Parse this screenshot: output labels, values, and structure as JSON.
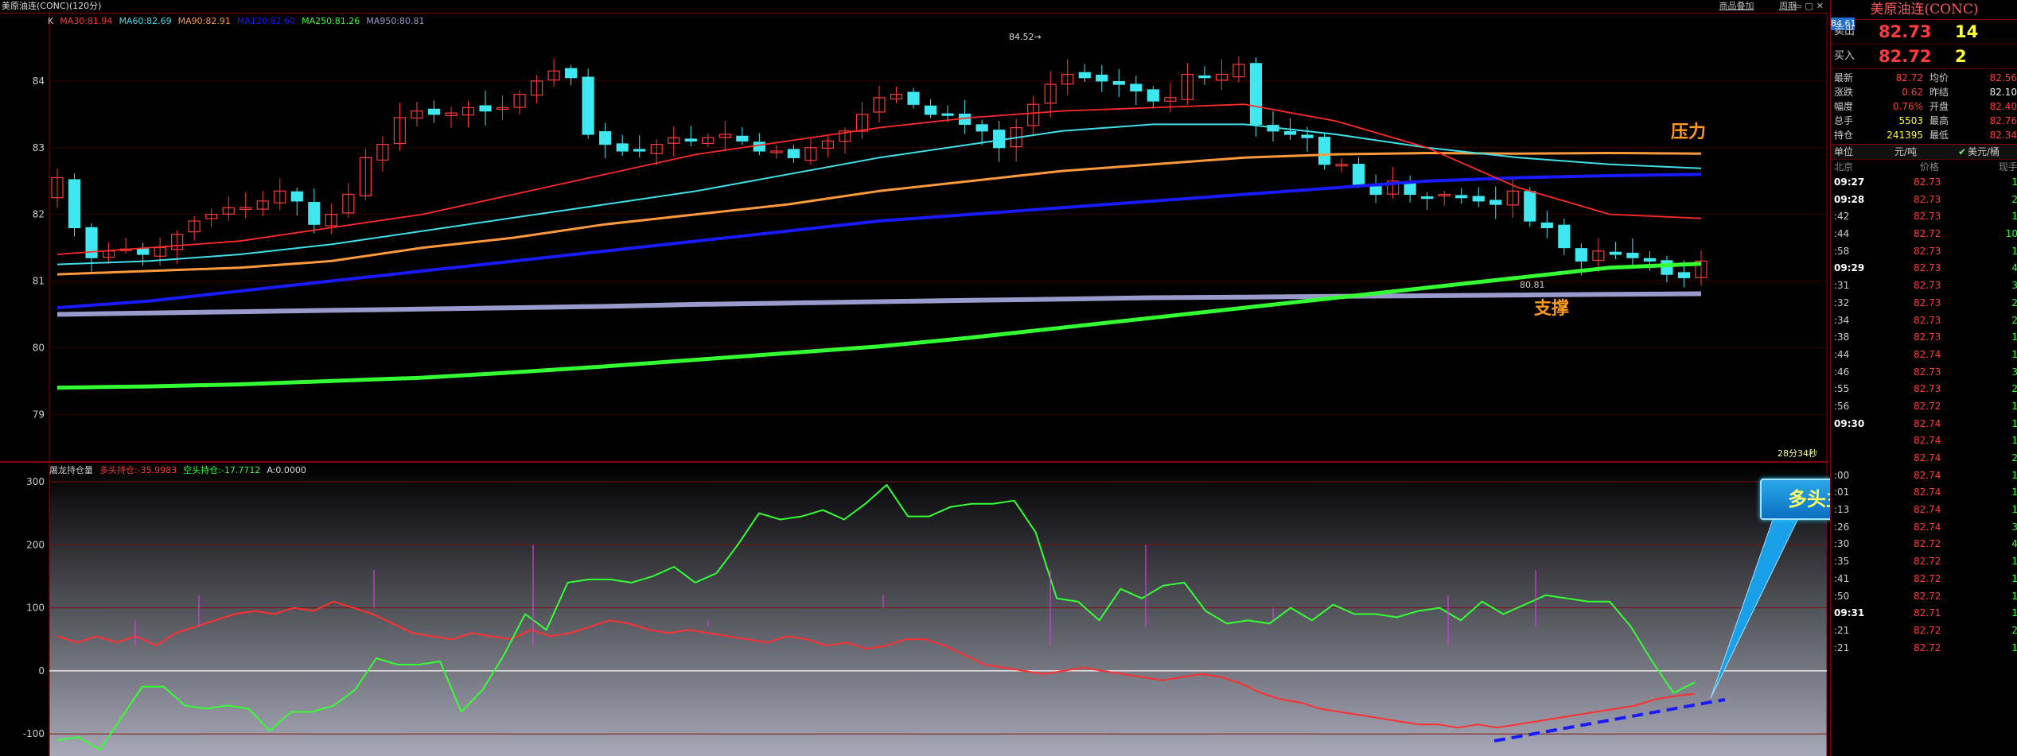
{
  "header": {
    "title": "美原油连(CONC)(120分)",
    "links": [
      "商品叠加",
      "周期"
    ],
    "current_price_tag": "84.61"
  },
  "indicators": {
    "main": [
      {
        "label": "K",
        "color": "#cccccc"
      },
      {
        "label": "MA30:81.94",
        "color": "#ff3b3b"
      },
      {
        "label": "MA60:82.69",
        "color": "#40e0e8"
      },
      {
        "label": "MA90:82.91",
        "color": "#ff9a3c"
      },
      {
        "label": "MA120:82.60",
        "color": "#1a1aff"
      },
      {
        "label": "MA250:81.26",
        "color": "#33ff33"
      },
      {
        "label": "MA950:80.81",
        "color": "#9a9acd"
      }
    ],
    "sub": [
      {
        "label": "屠龙持仓量",
        "color": "#cccccc"
      },
      {
        "label": "多头持仓:-35.9983",
        "color": "#ff3b3b"
      },
      {
        "label": "空头持仓:-17.7712",
        "color": "#33ff33"
      },
      {
        "label": "A:0.0000",
        "color": "#dddddd"
      }
    ],
    "timer": "28分34秒"
  },
  "annotations": {
    "pressure": "压力",
    "support": "支撑",
    "callout": "多头主力持续增仓",
    "high_label": "84.52",
    "low_label": "80.81"
  },
  "chart_data": [
    {
      "type": "candlestick",
      "title": "美原油连(CONC)(120分)",
      "ylim": [
        78.3,
        85.0
      ],
      "yticks": [
        79,
        80,
        81,
        82,
        83,
        84
      ],
      "n": 97,
      "closes": [
        82.55,
        81.8,
        81.35,
        81.45,
        81.48,
        81.4,
        81.5,
        81.7,
        81.9,
        82.0,
        82.1,
        82.1,
        82.2,
        82.35,
        82.2,
        81.85,
        82.0,
        82.3,
        82.85,
        83.05,
        83.45,
        83.55,
        83.5,
        83.52,
        83.6,
        83.55,
        83.6,
        83.8,
        84.0,
        84.15,
        84.05,
        83.2,
        83.05,
        82.95,
        82.95,
        83.05,
        83.15,
        83.1,
        83.15,
        83.2,
        83.1,
        82.95,
        82.95,
        82.85,
        83.0,
        83.1,
        83.25,
        83.5,
        83.75,
        83.8,
        83.65,
        83.5,
        83.5,
        83.35,
        83.25,
        83.0,
        83.3,
        83.65,
        83.95,
        84.1,
        84.05,
        84.0,
        83.95,
        83.85,
        83.7,
        83.75,
        84.1,
        84.05,
        84.1,
        84.25,
        83.35,
        83.25,
        83.2,
        83.15,
        82.75,
        82.75,
        82.45,
        82.3,
        82.5,
        82.3,
        82.25,
        82.3,
        82.25,
        82.2,
        82.15,
        82.35,
        81.9,
        81.8,
        81.5,
        81.3,
        81.45,
        81.4,
        81.35,
        81.3,
        81.1,
        81.05,
        81.3
      ],
      "ma30": [
        81.4,
        81.5,
        81.6,
        81.8,
        82.0,
        82.3,
        82.6,
        82.9,
        83.1,
        83.3,
        83.45,
        83.55,
        83.6,
        83.65,
        83.4,
        83.0,
        82.4,
        82.0,
        81.94
      ],
      "ma60": [
        81.25,
        81.3,
        81.4,
        81.55,
        81.75,
        81.95,
        82.15,
        82.35,
        82.6,
        82.85,
        83.05,
        83.25,
        83.35,
        83.35,
        83.2,
        83.0,
        82.85,
        82.75,
        82.69
      ],
      "ma90": [
        81.1,
        81.15,
        81.2,
        81.3,
        81.5,
        81.65,
        81.85,
        82.0,
        82.15,
        82.35,
        82.5,
        82.65,
        82.75,
        82.85,
        82.9,
        82.92,
        82.91,
        82.92,
        82.91
      ],
      "ma120": [
        80.6,
        80.7,
        80.85,
        81.0,
        81.15,
        81.3,
        81.45,
        81.6,
        81.75,
        81.9,
        82.0,
        82.1,
        82.2,
        82.3,
        82.4,
        82.5,
        82.55,
        82.58,
        82.6
      ],
      "ma250": [
        79.4,
        79.42,
        79.45,
        79.5,
        79.55,
        79.63,
        79.72,
        79.82,
        79.92,
        80.02,
        80.15,
        80.3,
        80.45,
        80.6,
        80.75,
        80.9,
        81.05,
        81.2,
        81.26
      ],
      "ma950": [
        80.5,
        80.52,
        80.54,
        80.56,
        80.58,
        80.6,
        80.62,
        80.65,
        80.67,
        80.69,
        80.71,
        80.73,
        80.75,
        80.76,
        80.77,
        80.78,
        80.79,
        80.8,
        80.81
      ]
    },
    {
      "type": "line",
      "title": "屠龙持仓量",
      "ylim": [
        -135,
        310
      ],
      "yticks": [
        -100,
        0,
        100,
        200,
        300
      ],
      "series": [
        {
          "name": "多头持仓",
          "color": "#ff3030",
          "values": [
            55,
            45,
            55,
            45,
            55,
            40,
            60,
            70,
            80,
            90,
            95,
            90,
            100,
            95,
            110,
            100,
            90,
            75,
            60,
            55,
            50,
            60,
            55,
            50,
            65,
            55,
            60,
            70,
            80,
            75,
            65,
            60,
            65,
            60,
            55,
            50,
            45,
            55,
            50,
            40,
            45,
            35,
            40,
            50,
            50,
            40,
            25,
            10,
            5,
            0,
            -5,
            0,
            5,
            0,
            -5,
            -10,
            -15,
            -10,
            -5,
            -10,
            -20,
            -35,
            -45,
            -50,
            -60,
            -65,
            -70,
            -75,
            -80,
            -85,
            -85,
            -90,
            -85,
            -90,
            -85,
            -80,
            -75,
            -70,
            -65,
            -60,
            -55,
            -45,
            -40,
            -36
          ]
        },
        {
          "name": "空头持仓",
          "color": "#33ff33",
          "values": [
            -110,
            -105,
            -125,
            -75,
            -25,
            -25,
            -55,
            -60,
            -55,
            -60,
            -95,
            -65,
            -65,
            -55,
            -30,
            20,
            10,
            10,
            15,
            -65,
            -30,
            25,
            90,
            65,
            140,
            145,
            145,
            140,
            150,
            165,
            140,
            155,
            200,
            250,
            240,
            245,
            255,
            240,
            265,
            295,
            245,
            245,
            260,
            265,
            265,
            270,
            220,
            115,
            110,
            80,
            130,
            115,
            135,
            140,
            95,
            75,
            80,
            75,
            100,
            80,
            105,
            90,
            90,
            85,
            95,
            100,
            80,
            110,
            90,
            105,
            120,
            115,
            110,
            110,
            70,
            15,
            -35,
            -18
          ]
        },
        {
          "name": "A",
          "color": "#dddddd",
          "values": [
            0
          ]
        }
      ]
    }
  ],
  "panel": {
    "title": "美原油连(CONC)",
    "sell": {
      "label": "卖出",
      "price": "82.73",
      "vol": "14"
    },
    "buy": {
      "label": "买入",
      "price": "82.72",
      "vol": "2"
    },
    "stats": [
      {
        "l1": "最新",
        "v1": "82.72",
        "c1": "red",
        "l2": "均价",
        "v2": "82.56",
        "c2": "red"
      },
      {
        "l1": "涨跌",
        "v1": "0.62",
        "c1": "red",
        "l2": "昨结",
        "v2": "82.10",
        "c2": "wht"
      },
      {
        "l1": "幅度",
        "v1": "0.76%",
        "c1": "red",
        "l2": "开盘",
        "v2": "82.40",
        "c2": "red"
      },
      {
        "l1": "总手",
        "v1": "5503",
        "c1": "yel",
        "l2": "最高",
        "v2": "82.76",
        "c2": "red"
      },
      {
        "l1": "持仓",
        "v1": "241395",
        "c1": "yel",
        "l2": "最低",
        "v2": "82.34",
        "c2": "red"
      }
    ],
    "unit": {
      "label": "单位",
      "value": "元/吨",
      "alt": "美元/桶"
    },
    "tick_head": {
      "loc": "北京",
      "price": "价格",
      "vol": "现手"
    },
    "ticks": [
      {
        "t": "09:27",
        "p": "82.73",
        "v": "1",
        "bold": true
      },
      {
        "t": "09:28",
        "p": "82.73",
        "v": "2",
        "bold": true
      },
      {
        "t": ":42",
        "p": "82.73",
        "v": "1"
      },
      {
        "t": ":44",
        "p": "82.72",
        "v": "10"
      },
      {
        "t": ":58",
        "p": "82.73",
        "v": "1"
      },
      {
        "t": "09:29",
        "p": "82.73",
        "v": "4",
        "bold": true
      },
      {
        "t": ":31",
        "p": "82.73",
        "v": "3"
      },
      {
        "t": ":32",
        "p": "82.73",
        "v": "2"
      },
      {
        "t": ":34",
        "p": "82.73",
        "v": "2"
      },
      {
        "t": ":38",
        "p": "82.73",
        "v": "1"
      },
      {
        "t": ":44",
        "p": "82.74",
        "v": "1"
      },
      {
        "t": ":46",
        "p": "82.73",
        "v": "3"
      },
      {
        "t": ":55",
        "p": "82.73",
        "v": "2"
      },
      {
        "t": ":56",
        "p": "82.72",
        "v": "1"
      },
      {
        "t": "09:30",
        "p": "82.74",
        "v": "1",
        "bold": true
      },
      {
        "t": "",
        "p": "82.74",
        "v": "1"
      },
      {
        "t": "",
        "p": "82.74",
        "v": "2"
      },
      {
        "t": ":00",
        "p": "82.74",
        "v": "1"
      },
      {
        "t": ":01",
        "p": "82.74",
        "v": "1"
      },
      {
        "t": ":13",
        "p": "82.74",
        "v": "1"
      },
      {
        "t": ":26",
        "p": "82.74",
        "v": "3"
      },
      {
        "t": ":30",
        "p": "82.72",
        "v": "4"
      },
      {
        "t": ":35",
        "p": "82.72",
        "v": "1"
      },
      {
        "t": ":41",
        "p": "82.72",
        "v": "1"
      },
      {
        "t": ":50",
        "p": "82.72",
        "v": "1"
      },
      {
        "t": "09:31",
        "p": "82.71",
        "v": "1",
        "bold": true
      },
      {
        "t": ":21",
        "p": "82.72",
        "v": "2"
      },
      {
        "t": ":21",
        "p": "82.72",
        "v": "1"
      }
    ]
  }
}
